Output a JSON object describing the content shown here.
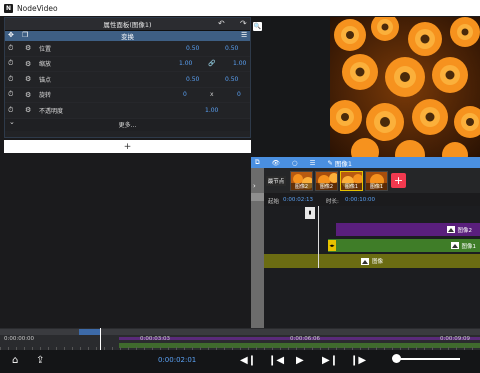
{
  "window": {
    "title": "NodeVideo",
    "logo": "N"
  },
  "props": {
    "title": "属性面板(图像1)",
    "section": "变换",
    "rows": [
      {
        "label": "位置",
        "v1": "0.50",
        "mid": "",
        "v2": "0.50"
      },
      {
        "label": "缩放",
        "v1": "1.00",
        "mid": "🔗",
        "v2": "1.00"
      },
      {
        "label": "锚点",
        "v1": "0.50",
        "mid": "",
        "v2": "0.50"
      },
      {
        "label": "旋转",
        "v1": "0",
        "mid": "x",
        "v2": "0"
      },
      {
        "label": "不透明度",
        "v1": "1.00",
        "mid": "",
        "v2": ""
      }
    ],
    "more": "更多...",
    "add": "+"
  },
  "timeline": {
    "toolbar_label": "图像1",
    "tag": "最节点",
    "thumbs": [
      "图像2",
      "图像2",
      "图像1",
      "图像1"
    ],
    "add": "+",
    "start_label": "起始",
    "start_value": "0:00:02:13",
    "duration_label": "时长:",
    "duration_value": "0:00:10:00",
    "clips": {
      "purple": "图像2",
      "green": "图像1",
      "olive": "图像"
    }
  },
  "ruler": {
    "t0": "0:00:00:00",
    "t1": "0:00:03:03",
    "t2": "0:00:06:06",
    "t3": "0:00:09:09"
  },
  "controls": {
    "current_time": "0:00:02:01"
  },
  "colors": {
    "accent": "#4a8fe0",
    "value": "#5aa0f2",
    "add": "#f2394f"
  }
}
